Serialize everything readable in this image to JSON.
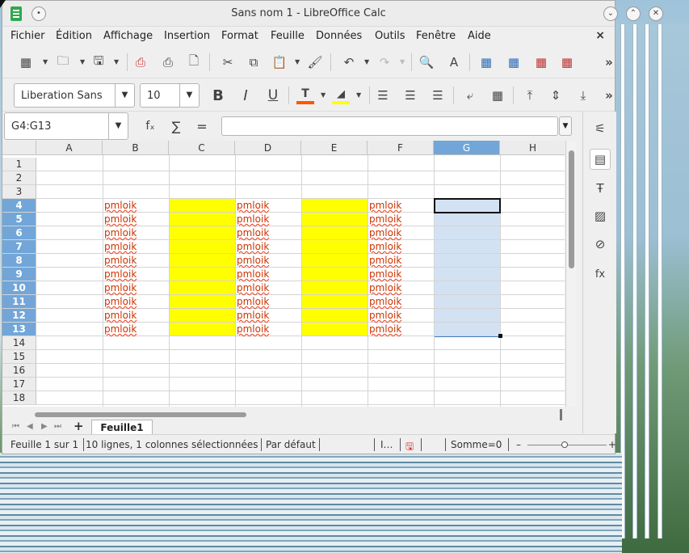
{
  "window": {
    "title": "Sans nom 1 - LibreOffice Calc",
    "minimize_icon": "chevron-down-icon",
    "maximize_icon": "chevron-up-icon",
    "close_icon": "close-icon"
  },
  "menubar": {
    "items": [
      "Fichier",
      "Édition",
      "Affichage",
      "Insertion",
      "Format",
      "Feuille",
      "Données",
      "Outils",
      "Fenêtre",
      "Aide"
    ],
    "close_label": "×"
  },
  "font_toolbar": {
    "font_name": "Liberation Sans",
    "font_size": "10",
    "bold": "B",
    "italic": "I",
    "underline": "U",
    "font_color": "#ff5500",
    "highlight_color": "#ffff00"
  },
  "formula_bar": {
    "name_box": "G4:G13",
    "fx_label": "fₓ",
    "sum_label": "∑",
    "equals_label": "=",
    "formula_value": ""
  },
  "sheet": {
    "columns": [
      "A",
      "B",
      "C",
      "D",
      "E",
      "F",
      "G",
      "H"
    ],
    "selected_column": "G",
    "rows": [
      "1",
      "2",
      "3",
      "4",
      "5",
      "6",
      "7",
      "8",
      "9",
      "10",
      "11",
      "12",
      "13",
      "14",
      "15",
      "16",
      "17",
      "18"
    ],
    "selected_rows": [
      "4",
      "5",
      "6",
      "7",
      "8",
      "9",
      "10",
      "11",
      "12",
      "13"
    ],
    "cell_text": "pmloik",
    "text_columns": [
      "B",
      "D",
      "F"
    ],
    "yellow_columns": [
      "C",
      "E"
    ],
    "fill_color": "#ffff00",
    "selection_color": "#d3e2f2"
  },
  "tabs": {
    "add_label": "+",
    "sheet_tab": "Feuille1"
  },
  "statusbar": {
    "sheet_info": "Feuille 1 sur 1",
    "selection_info": "10 lignes, 1 colonnes sélectionnées",
    "style": "Par défaut",
    "insert_mode": "I…",
    "sum": "Somme=0",
    "zoom_minus": "–",
    "zoom_plus": "+"
  }
}
